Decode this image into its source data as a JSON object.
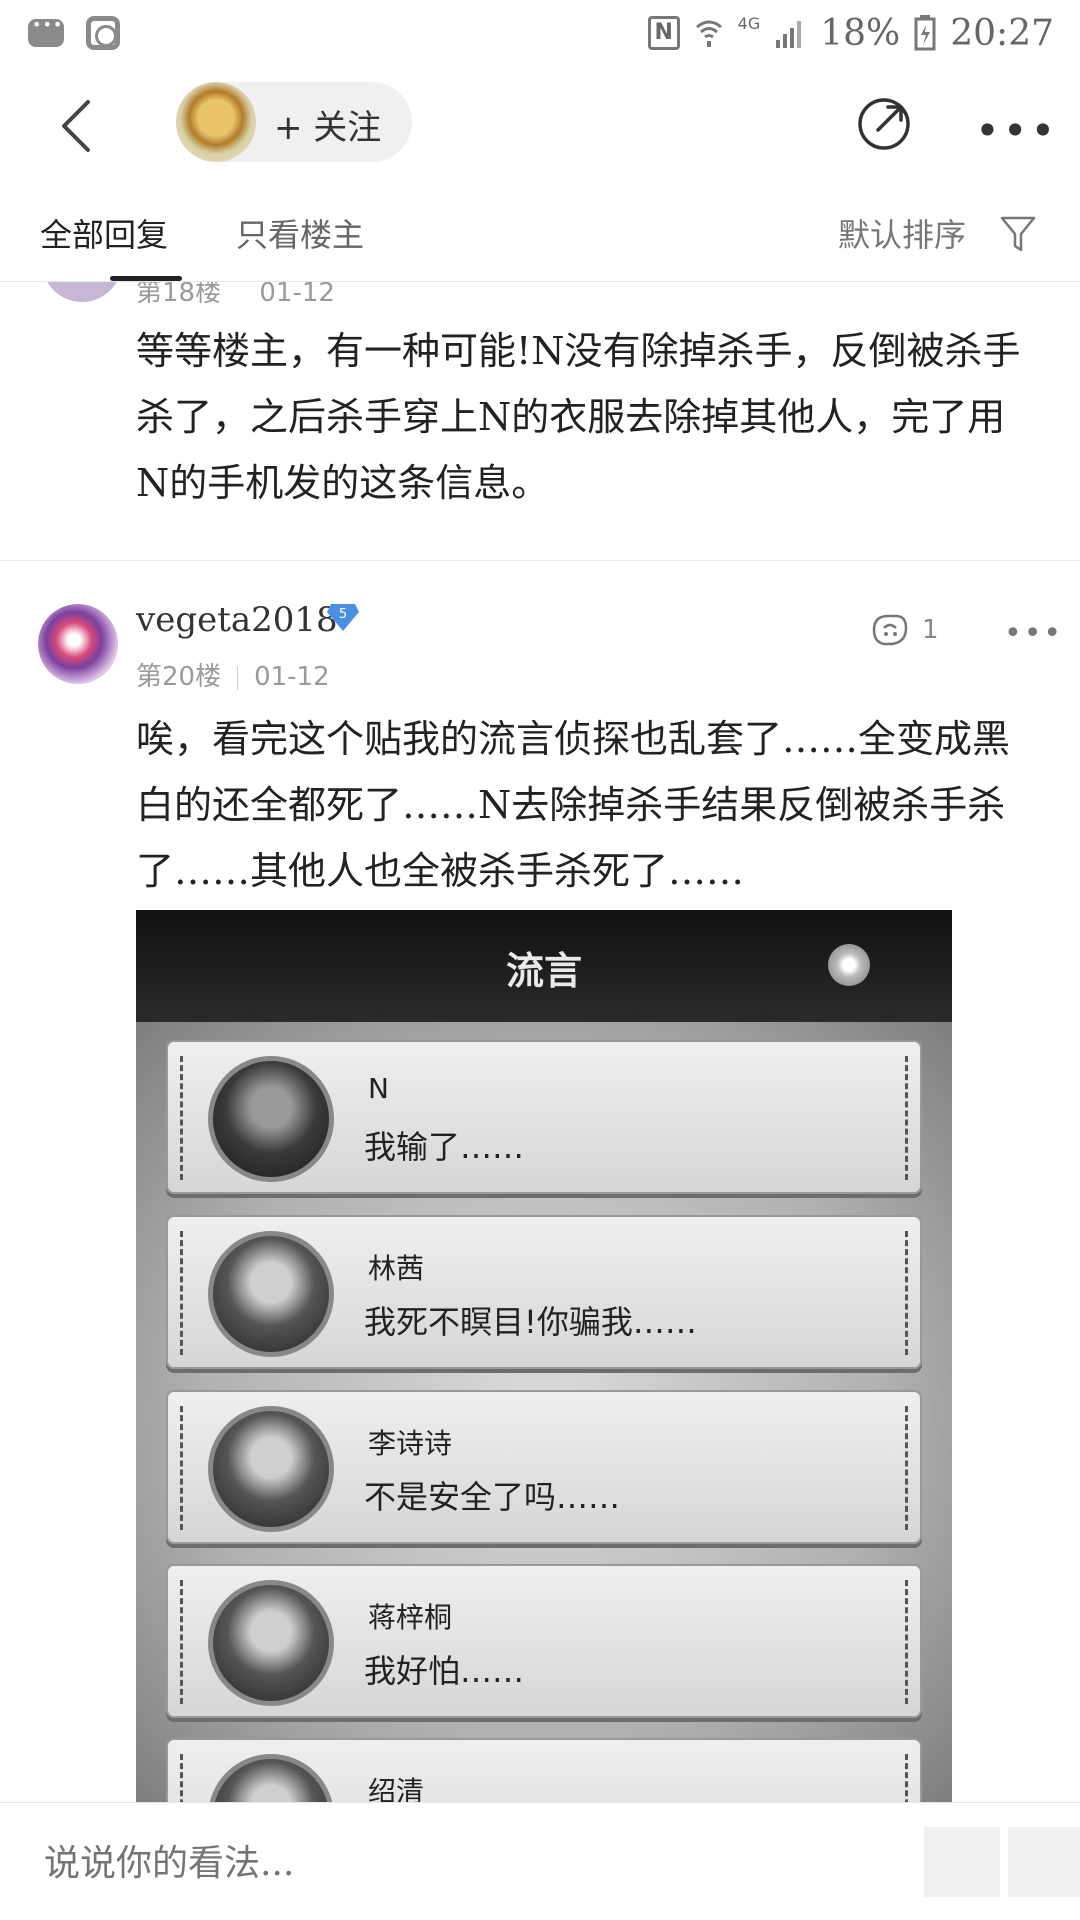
{
  "status_bar": {
    "network": "4G",
    "battery": "18%",
    "time": "20:27"
  },
  "header": {
    "follow_label": "+ 关注",
    "share_icon": "share-icon",
    "more_icon": "more-icon"
  },
  "tabs": {
    "all_replies": "全部回复",
    "only_op": "只看楼主",
    "sort_label": "默认排序"
  },
  "posts": [
    {
      "meta_floor": "第18楼",
      "meta_date": "01-12",
      "text": "等等楼主，有一种可能!N没有除掉杀手，反倒被杀手杀了，之后杀手穿上N的衣服去除掉其他人，完了用N的手机发的这条信息。"
    },
    {
      "username": "vegeta2018",
      "level": "5",
      "floor": "第20楼",
      "date": "01-12",
      "likes": "1",
      "text": "唉，看完这个贴我的流言侦探也乱套了……全变成黑白的还全都死了……N去除掉杀手结果反倒被杀手杀了……其他人也全被杀手杀死了……",
      "image": {
        "title": "流言",
        "cards": [
          {
            "name": "N",
            "message": "我输了……"
          },
          {
            "name": "林茜",
            "message": "我死不瞑目!你骗我……"
          },
          {
            "name": "李诗诗",
            "message": "不是安全了吗……"
          },
          {
            "name": "蒋梓桐",
            "message": "我好怕……"
          },
          {
            "name": "绍清",
            "message": ""
          }
        ]
      }
    }
  ],
  "comment_bar": {
    "placeholder": "说说你的看法..."
  }
}
